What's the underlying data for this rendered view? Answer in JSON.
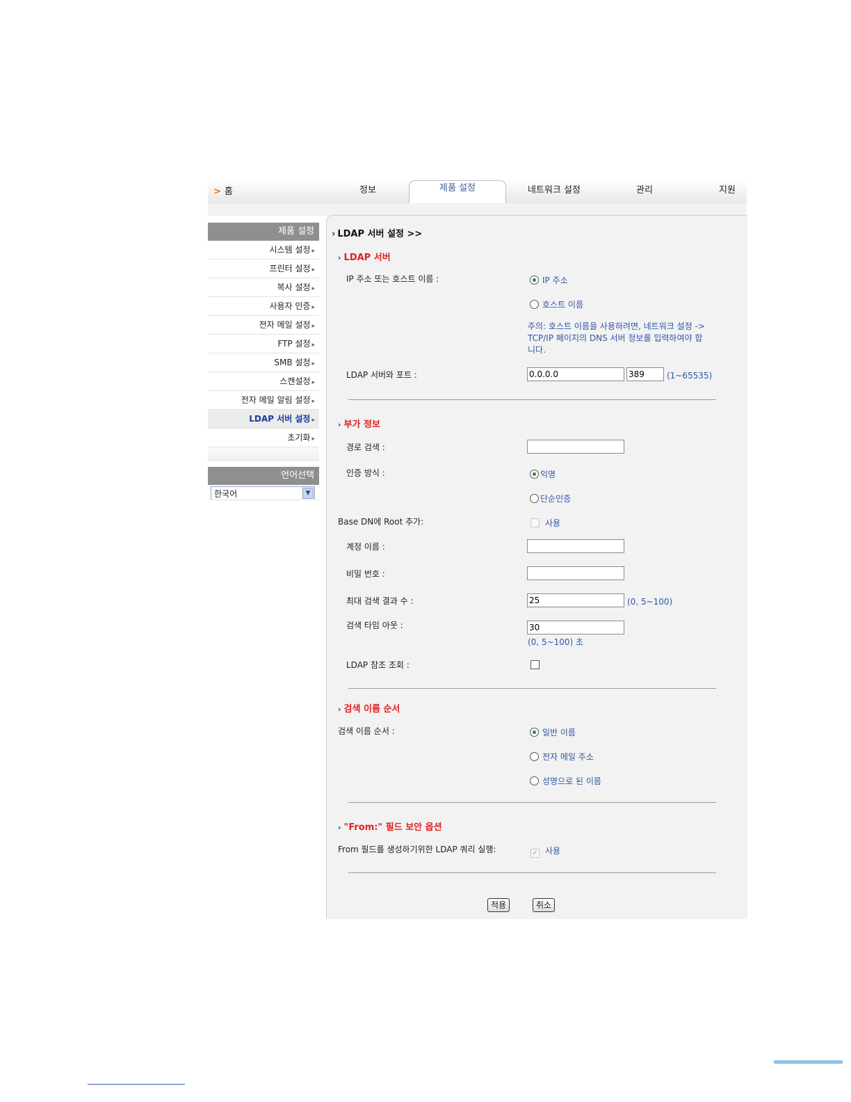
{
  "topnav": {
    "home": "홈",
    "tabs": [
      "정보",
      "제품 설정",
      "네트워크 설정",
      "관리",
      "지원"
    ]
  },
  "sidebar": {
    "header": "제품 설정",
    "items": [
      {
        "label": "시스템 설정"
      },
      {
        "label": "프린터 설정"
      },
      {
        "label": "복사 설정"
      },
      {
        "label": "사용자 인증"
      },
      {
        "label": "전자 메일 설정"
      },
      {
        "label": "FTP 설정"
      },
      {
        "label": "SMB 설정"
      },
      {
        "label": "스캔설정"
      },
      {
        "label": "전자 메일 알림 설정"
      },
      {
        "label": "LDAP 서버 설정",
        "active": true
      },
      {
        "label": "초기화"
      }
    ],
    "language_header": "언어선택",
    "language_value": "한국어"
  },
  "main": {
    "page_title": "LDAP 서버 설정 >>",
    "ldap_server": {
      "title": "LDAP 서버",
      "ip_or_host_label": "IP 주소 또는 호스트 이름 :",
      "ip_option": "IP 주소",
      "host_option": "호스트 이름",
      "note": "주의: 호스트 이름을 사용하려면, 네트워크 설정 -> TCP/IP 페이지의 DNS 서버 정보를 입력하여야 합니다.",
      "server_port_label": "LDAP 서버와 포트 :",
      "server_value": "0.0.0.0",
      "port_value": "389",
      "port_range": "(1~65535)"
    },
    "additional": {
      "title": "부가 정보",
      "search_path_label": "경로 검색 :",
      "auth_method_label": "인증 방식 :",
      "auth_anonymous": "익명",
      "auth_simple": "단순인증",
      "base_dn_label": "Base DN에 Root 추가:",
      "use_label": "사용",
      "account_label": "계정 이름 :",
      "password_label": "비밀 번호 :",
      "max_results_label": "최대 검색 결과 수 :",
      "max_results_value": "25",
      "max_results_range": "(0, 5~100)",
      "timeout_label": "검색 타임 아웃 :",
      "timeout_value": "30",
      "timeout_range": "(0, 5~100) 초",
      "referral_label": "LDAP 참조 조회 :"
    },
    "name_order": {
      "title": "검색 이름 순서",
      "label": "검색 이름 순서 :",
      "options": [
        "일반 이름",
        "전자 메일 주소",
        "성명으로 된 이름"
      ]
    },
    "from_security": {
      "title": "\"From:\" 필드 보안 옵션",
      "label": "From 필드를 생성하기위한 LDAP 쿼리 실행:",
      "use_label": "사용"
    },
    "buttons": {
      "apply": "적용",
      "cancel": "취소"
    }
  }
}
